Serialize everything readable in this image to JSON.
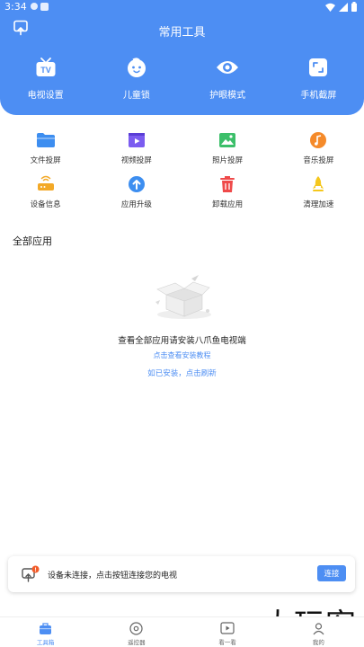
{
  "status_bar": {
    "time": "3:34"
  },
  "header": {
    "title": "常用工具"
  },
  "top_tools": [
    {
      "label": "电视设置",
      "icon": "tv-icon"
    },
    {
      "label": "儿童锁",
      "icon": "child-face-icon"
    },
    {
      "label": "护眼模式",
      "icon": "eye-icon"
    },
    {
      "label": "手机截屏",
      "icon": "screenshot-icon"
    }
  ],
  "tools_row1": [
    {
      "label": "文件投屏",
      "icon": "folder-icon",
      "color": "#3d8ef0"
    },
    {
      "label": "视频投屏",
      "icon": "video-icon",
      "color": "#7b5cf0"
    },
    {
      "label": "照片投屏",
      "icon": "photo-icon",
      "color": "#3cbf6a"
    },
    {
      "label": "音乐投屏",
      "icon": "music-icon",
      "color": "#f58a2a"
    }
  ],
  "tools_row2": [
    {
      "label": "设备信息",
      "icon": "router-icon",
      "color": "#f3a927"
    },
    {
      "label": "应用升级",
      "icon": "upgrade-icon",
      "color": "#3d8ef0"
    },
    {
      "label": "卸载应用",
      "icon": "trash-icon",
      "color": "#ef4a4a"
    },
    {
      "label": "清理加速",
      "icon": "rocket-icon",
      "color": "#f5c71c"
    }
  ],
  "all_apps": {
    "title": "全部应用",
    "empty_message": "查看全部应用请安装八爪鱼电视端",
    "tutorial_link": "点击查看安装教程",
    "refresh_link": "如已安装，点击刷新"
  },
  "connect_bar": {
    "message": "设备未连接，点击按钮连接您的电视",
    "button": "连接",
    "badge": "!"
  },
  "bottom_nav": [
    {
      "label": "工具箱",
      "icon": "toolbox-icon",
      "active": true
    },
    {
      "label": "遥控器",
      "icon": "remote-icon",
      "active": false
    },
    {
      "label": "看一看",
      "icon": "watch-icon",
      "active": false
    },
    {
      "label": "我的",
      "icon": "profile-icon",
      "active": false
    }
  ],
  "watermark": "大玩客",
  "colors": {
    "accent": "#4d8ef3"
  }
}
